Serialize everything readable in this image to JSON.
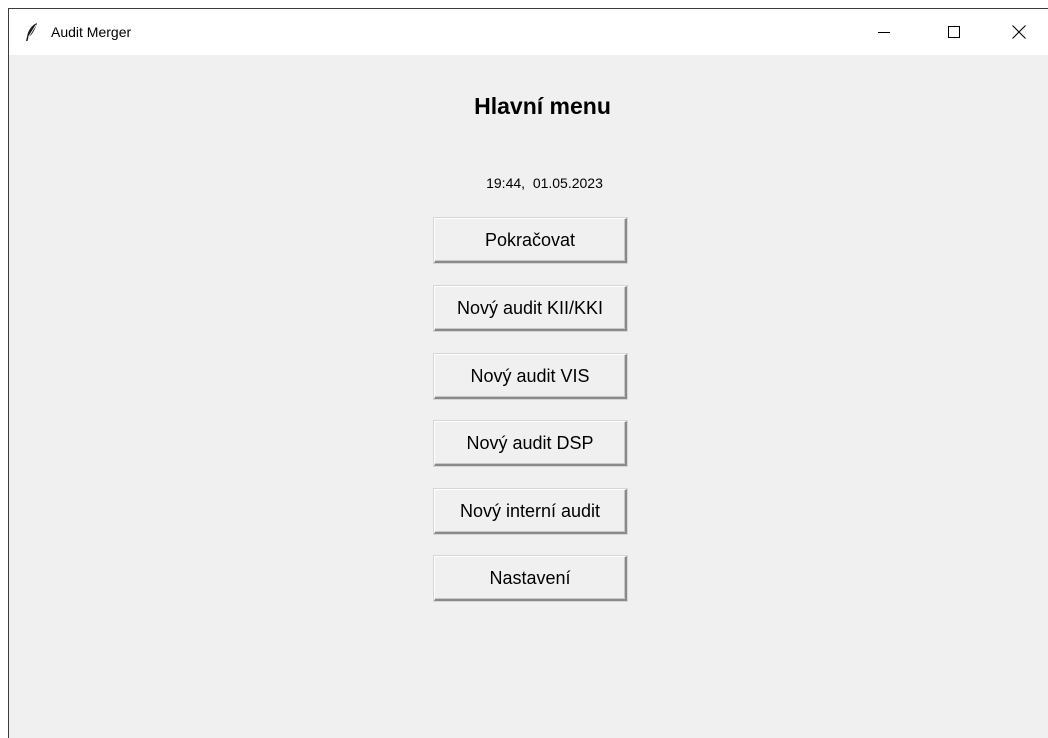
{
  "window": {
    "title": "Audit Merger",
    "app_icon": "feather-icon",
    "controls": {
      "minimize_icon": "minimize-icon",
      "maximize_icon": "maximize-icon",
      "close_icon": "close-icon"
    }
  },
  "main": {
    "heading": "Hlavní menu",
    "datetime": "19:44,  01.05.2023",
    "buttons": [
      {
        "label": "Pokračovat"
      },
      {
        "label": "Nový audit KII/KKI"
      },
      {
        "label": "Nový audit VIS"
      },
      {
        "label": "Nový audit DSP"
      },
      {
        "label": "Nový interní audit"
      },
      {
        "label": "Nastavení"
      }
    ]
  },
  "colors": {
    "background": "#f0f0f0",
    "titlebar": "#ffffff",
    "text": "#000000"
  }
}
